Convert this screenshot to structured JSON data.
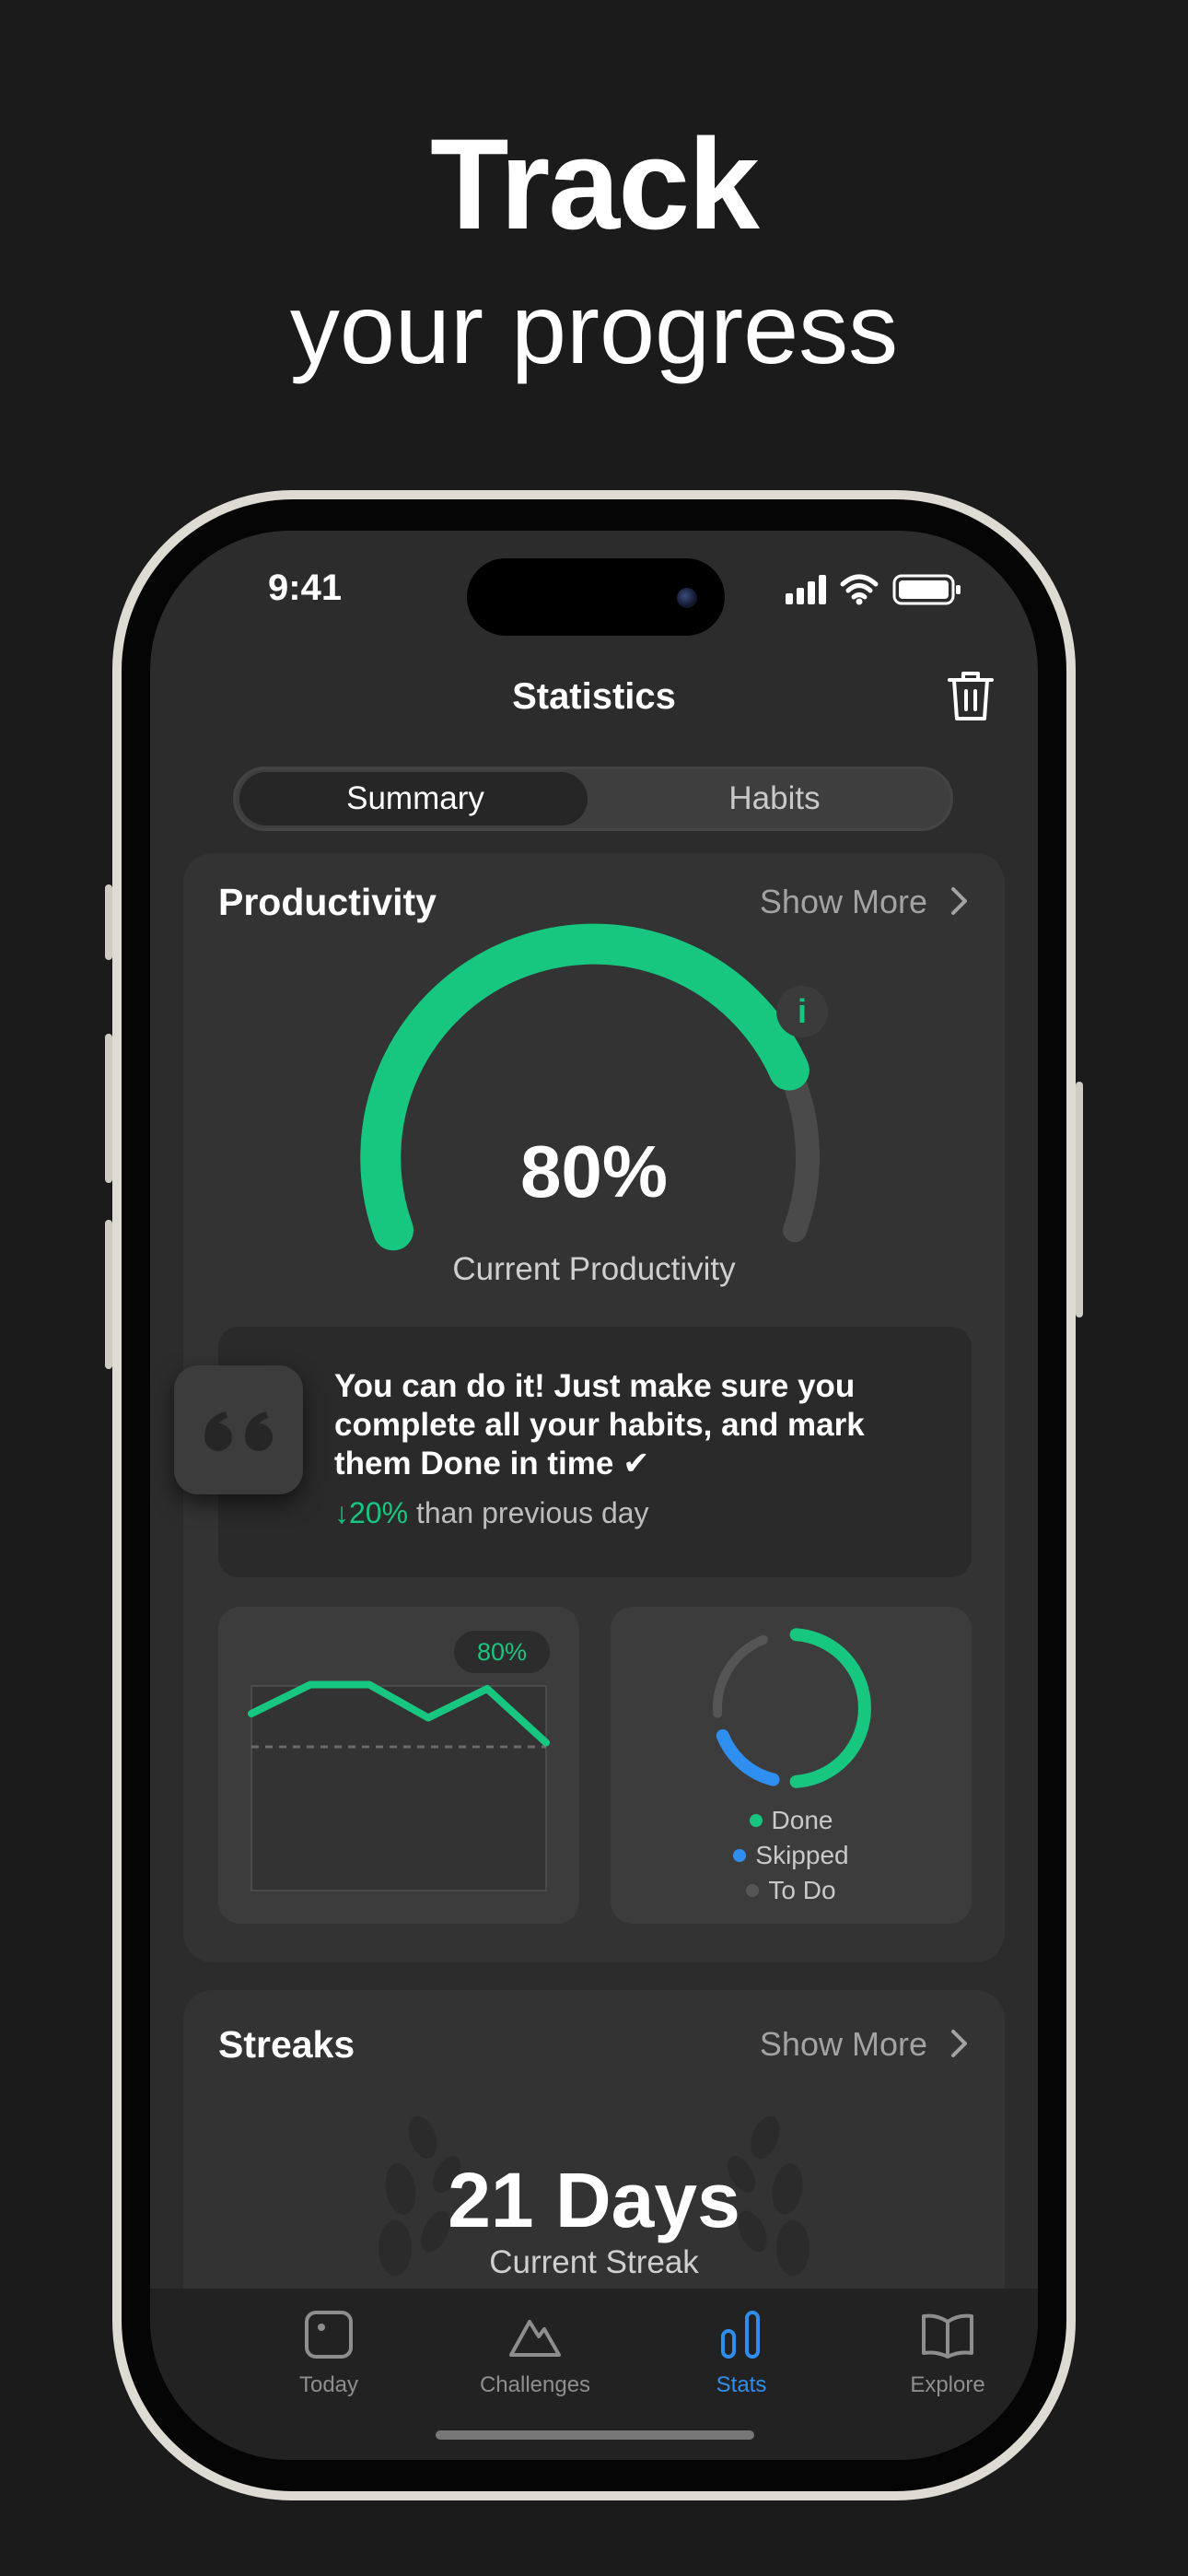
{
  "hero": {
    "line1": "Track",
    "line2": "your progress"
  },
  "status_bar": {
    "time": "9:41"
  },
  "header": {
    "title": "Statistics",
    "trash_icon": "trash-icon"
  },
  "segments": {
    "summary": "Summary",
    "habits": "Habits",
    "selected": "Summary"
  },
  "productivity": {
    "title": "Productivity",
    "show_more": "Show More",
    "gauge_value": "80%",
    "gauge_fraction": 0.8,
    "caption": "Current Productivity",
    "info_label": "i",
    "quote_text": "You can do it! Just make sure you complete all your habits, and mark them Done in time ✔",
    "change_pct": "↓20%",
    "change_text": " than previous day",
    "mini_chart": {
      "badge": "80%",
      "values": [
        78,
        85,
        85,
        77,
        84,
        71
      ],
      "reference": 70,
      "ylim": [
        0,
        100
      ]
    },
    "ring": {
      "legend": [
        "Done",
        "Skipped",
        "To Do"
      ],
      "fractions": {
        "done": 0.5,
        "skipped": 0.15,
        "todo": 0.2
      },
      "colors": {
        "done": "#17c77f",
        "skipped": "#2f8ff0",
        "todo": "#555555"
      }
    }
  },
  "streaks": {
    "title": "Streaks",
    "show_more": "Show More",
    "value": "21 Days",
    "caption": "Current Streak"
  },
  "tabs": [
    {
      "label": "Today",
      "icon": "today-icon"
    },
    {
      "label": "Challenges",
      "icon": "mountain-icon"
    },
    {
      "label": "Stats",
      "icon": "bar-chart-icon"
    },
    {
      "label": "Explore",
      "icon": "book-icon"
    }
  ],
  "active_tab": "Stats",
  "colors": {
    "accent_green": "#17c77f",
    "accent_blue": "#2f8ff0",
    "background": "#1b1b1b",
    "card": "#333333"
  }
}
